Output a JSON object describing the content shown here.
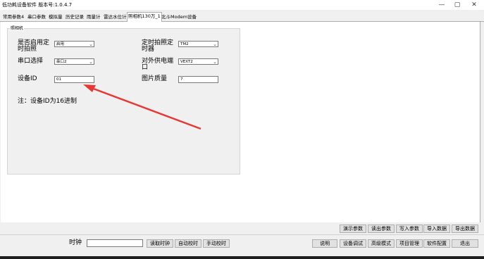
{
  "app": {
    "title": "低功耗设备软件  版本号:1.0.4.7",
    "controls": {
      "minimize": "—",
      "maximize": "▢",
      "close": "✕"
    }
  },
  "tabs": [
    {
      "label": "常用参数4"
    },
    {
      "label": "串口参数"
    },
    {
      "label": "模拟量"
    },
    {
      "label": "历史记录"
    },
    {
      "label": "雨量计"
    },
    {
      "label": "雷达水位计"
    },
    {
      "label": "照相机130万_1"
    },
    {
      "label": "北斗Modem设备"
    }
  ],
  "group": {
    "title": "照相机",
    "enable_capture": {
      "label": "是否启用定时拍照",
      "value": "启用"
    },
    "timer_capture": {
      "label": "定时拍照定时器",
      "value": "TM2"
    },
    "serial_select": {
      "label": "串口选择",
      "value": "串口2"
    },
    "power_port": {
      "label": "对外供电端口",
      "value": "VEXT2"
    },
    "device_id": {
      "label": "设备ID",
      "value": "01"
    },
    "image_quality": {
      "label": "图片质量",
      "value": "7"
    },
    "note": "注：设备ID为16进制"
  },
  "action_buttons": [
    "演示参数",
    "读出参数",
    "写入参数",
    "导入数据",
    "导出数据"
  ],
  "bottom": {
    "clock_label": "时钟",
    "clock_value": "",
    "read_clock": "读取时钟",
    "auto_sync": "自动校时",
    "manual_sync": "手动校时",
    "help": "说明",
    "debug": "设备调试",
    "advanced": "高级模式",
    "project": "项目管理",
    "config": "软件配置",
    "exit": "退出"
  },
  "colors": {
    "arrow": "#e53935",
    "tab_active": "#ffffff",
    "panel": "#ffffff",
    "window": "#f0f0f0"
  }
}
